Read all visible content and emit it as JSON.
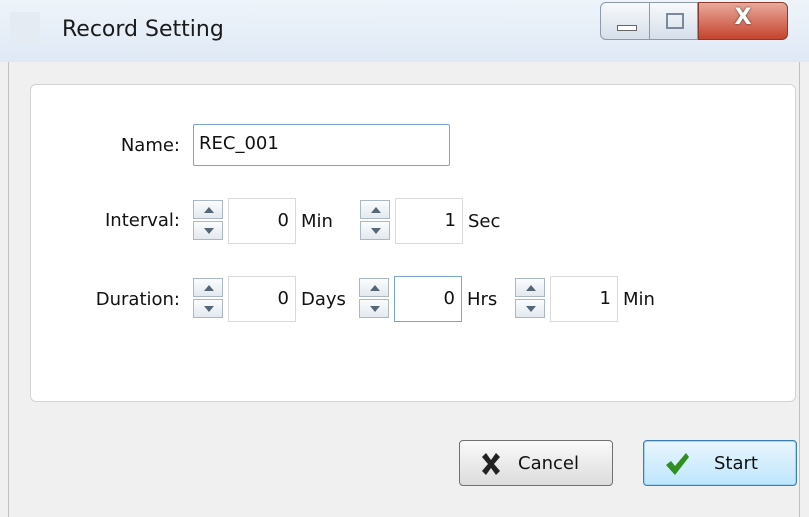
{
  "window": {
    "title": "Record Setting",
    "close_glyph": "X",
    "icons": [
      "minimize-icon",
      "maximize-icon",
      "close-icon"
    ]
  },
  "form": {
    "name_label": "Name:",
    "name_value": "REC_001",
    "interval_label": "Interval:",
    "interval_min_value": "0",
    "interval_min_unit": "Min",
    "interval_sec_value": "1",
    "interval_sec_unit": "Sec",
    "duration_label": "Duration:",
    "duration_days_value": "0",
    "duration_days_unit": "Days",
    "duration_hrs_value": "0",
    "duration_hrs_unit": "Hrs",
    "duration_min_value": "1",
    "duration_min_unit": "Min"
  },
  "buttons": {
    "cancel_label": "Cancel",
    "start_label": "Start"
  },
  "colors": {
    "cancel_icon": "#222222",
    "start_icon": "#2f8f1f",
    "close_button": "#c5432d",
    "focus_border": "#7aa3d6"
  }
}
